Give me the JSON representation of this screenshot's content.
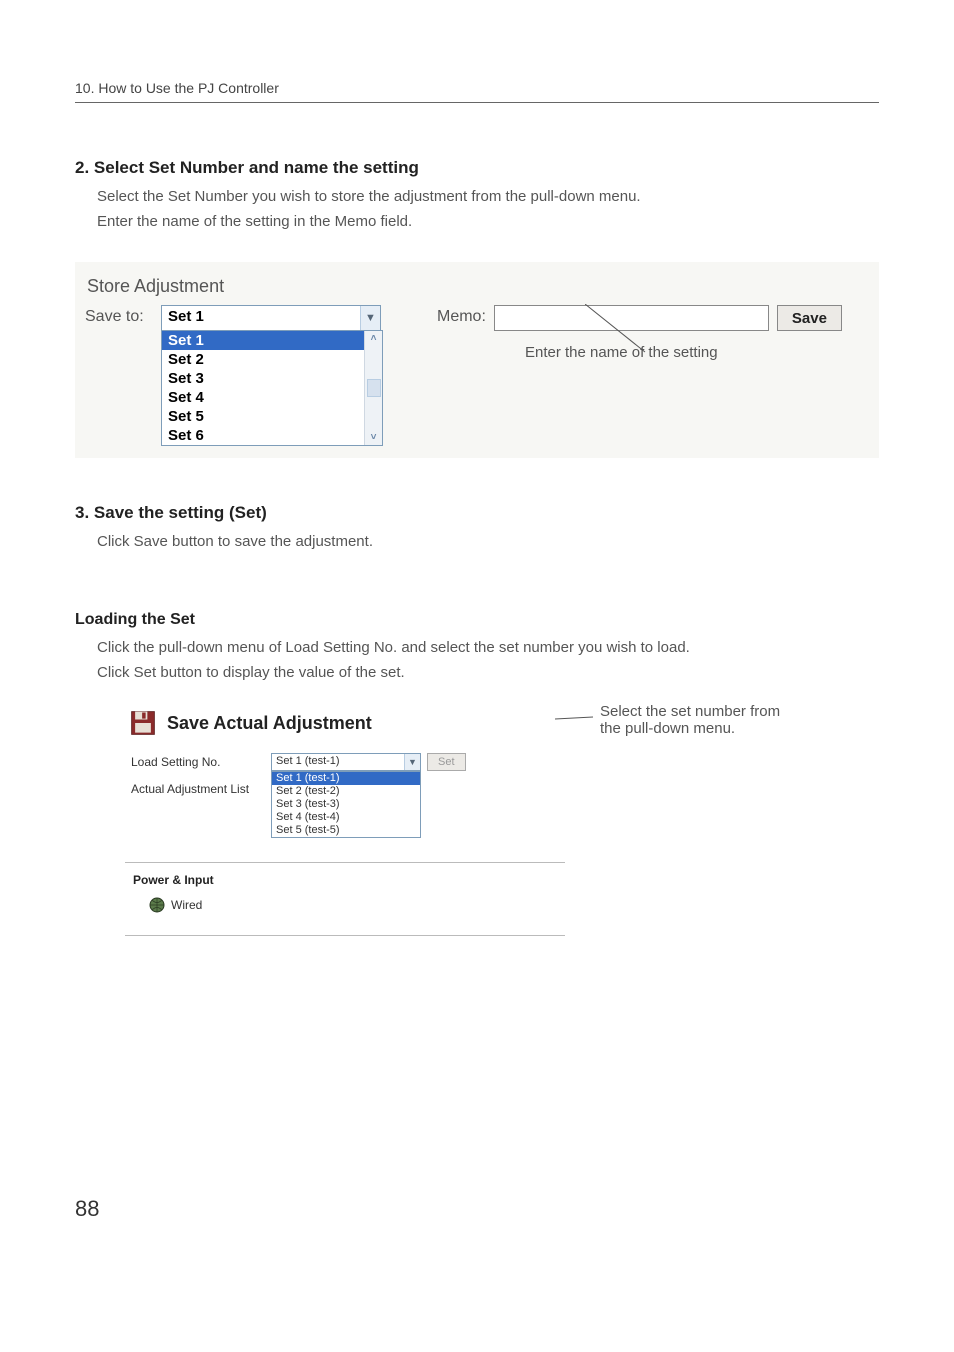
{
  "chapter": "10. How to Use the PJ Controller",
  "step2": {
    "title": "2. Select Set Number and name the setting",
    "p1": "Select the Set Number you wish to store the adjustment from the pull-down menu.",
    "p2": "Enter the name of the setting in the Memo field."
  },
  "shot1": {
    "panel_title": "Store Adjustment",
    "save_to_label": "Save to:",
    "combo_value": "Set 1",
    "list": [
      "Set 1",
      "Set 2",
      "Set 3",
      "Set 4",
      "Set 5",
      "Set 6"
    ],
    "memo_label": "Memo:",
    "save_button": "Save",
    "callout": "Enter the name of the setting"
  },
  "step3": {
    "title": "3. Save the setting (Set)",
    "p1": "Click Save button to save the adjustment."
  },
  "loading": {
    "title": "Loading the Set",
    "p1": "Click the pull-down menu of Load Setting No. and select the set number you wish to load.",
    "p2": "Click Set button to display the value of the set."
  },
  "shot2": {
    "title": "Save Actual Adjustment",
    "load_label": "Load Setting No.",
    "combo_value": "Set 1 (test-1)",
    "set_button": "Set",
    "list": [
      "Set 1 (test-1)",
      "Set 2 (test-2)",
      "Set 3 (test-3)",
      "Set 4 (test-4)",
      "Set 5 (test-5)"
    ],
    "actual_label": "Actual Adjustment List",
    "section_title": "Power & Input",
    "wired_label": "Wired"
  },
  "callout2": {
    "l1": "Select the set number from",
    "l2": "the pull-down menu."
  },
  "page_number": "88"
}
